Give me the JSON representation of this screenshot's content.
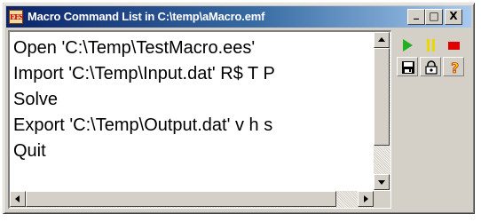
{
  "window": {
    "title": "Macro Command List in C:\\temp\\aMacro.emf",
    "app_icon_text": "EES",
    "controls": {
      "minimize": "_",
      "maximize": "□",
      "close": "X"
    }
  },
  "macro": {
    "lines": [
      "Open 'C:\\Temp\\TestMacro.ees'",
      "Import 'C:\\Temp\\Input.dat' R$ T P",
      "Solve",
      "Export 'C:\\Temp\\Output.dat' v h s",
      "Quit"
    ]
  },
  "toolbar": {
    "buttons": [
      {
        "name": "run-button",
        "icon": "play-icon",
        "color": "#20b020"
      },
      {
        "name": "pause-button",
        "icon": "pause-icon",
        "color": "#e8d800"
      },
      {
        "name": "stop-button",
        "icon": "stop-icon",
        "color": "#e00000"
      },
      {
        "name": "save-button",
        "icon": "save-icon",
        "color": "#000000"
      },
      {
        "name": "lock-button",
        "icon": "lock-icon",
        "color": "#000000"
      },
      {
        "name": "help-button",
        "icon": "help-icon",
        "color": "#e00000",
        "label": "?"
      }
    ]
  },
  "colors": {
    "titlebar_start": "#0a246a",
    "titlebar_end": "#a6caf0",
    "face": "#d4d0c8"
  }
}
